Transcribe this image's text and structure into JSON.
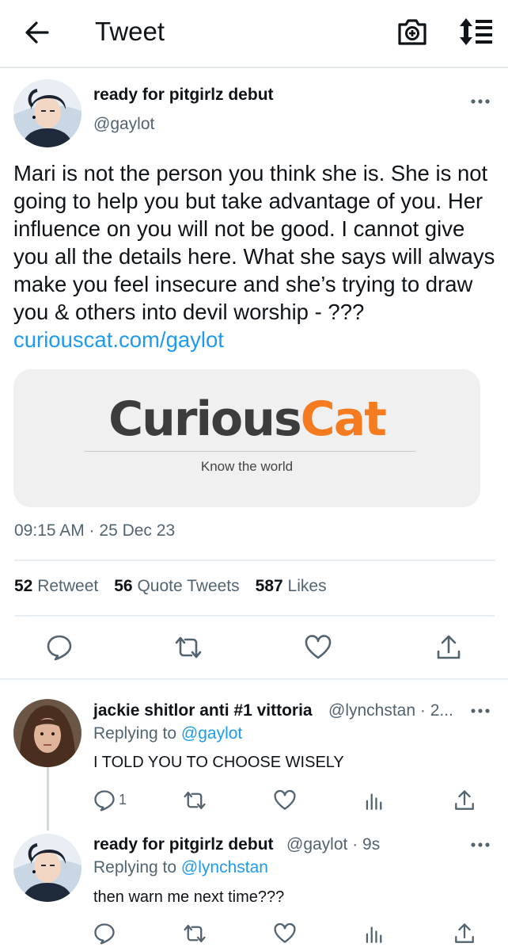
{
  "header": {
    "title": "Tweet"
  },
  "main_tweet": {
    "display_name": "ready for pitgirlz debut",
    "handle": "@gaylot",
    "body": "Mari is not the person you think she is. She is not going to help you but take advantage of you. Her influence on you will not be good. I cannot give you all the details here. What she says will always make you feel insecure and she’s trying to draw you & others into devil worship  - ??? ",
    "link": "curiouscat.com/gaylot",
    "card": {
      "logo_part1": "Curious",
      "logo_part2": "Cat",
      "tagline": "Know the world"
    },
    "timestamp": "09:15 AM · 25 Dec 23",
    "stats": {
      "retweets": "52",
      "retweets_label": "Retweet",
      "quotes": "56",
      "quotes_label": "Quote Tweets",
      "likes": "587",
      "likes_label": "Likes"
    }
  },
  "replies": [
    {
      "display_name": "jackie shitlor anti #1 vittoria",
      "meta": "@lynchstan · 2...",
      "replying_prefix": "Replying to ",
      "replying_to": "@gaylot",
      "text": "I TOLD YOU TO CHOOSE WISELY",
      "reply_count": "1"
    },
    {
      "display_name": "ready for pitgirlz debut",
      "meta": "@gaylot · 9s",
      "replying_prefix": "Replying to ",
      "replying_to": "@lynchstan",
      "text": "then warn me next time???"
    }
  ],
  "icons": [
    "back-arrow-icon",
    "camera-plus-icon",
    "sort-icon",
    "more-icon",
    "reply-icon",
    "retweet-icon",
    "like-icon",
    "share-icon",
    "analytics-icon"
  ],
  "colors": {
    "link": "#1d9bf0",
    "muted": "#536471",
    "text": "#0f1419",
    "brand_orange": "#f47b20"
  }
}
